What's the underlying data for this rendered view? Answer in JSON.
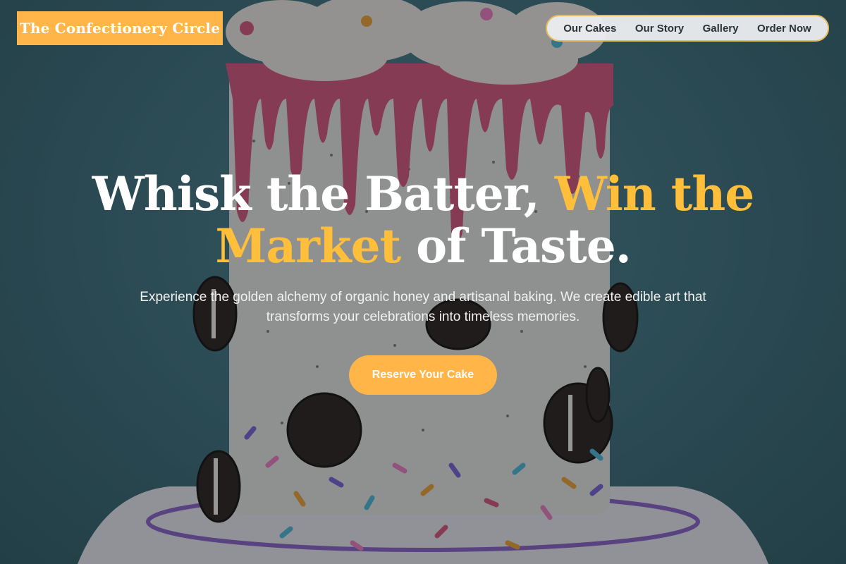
{
  "brand": {
    "name": "The Confectionery Circle"
  },
  "nav": {
    "items": [
      {
        "label": "Our Cakes"
      },
      {
        "label": "Our Story"
      },
      {
        "label": "Gallery"
      },
      {
        "label": "Order Now"
      }
    ]
  },
  "hero": {
    "title_part1": "Whisk the Batter,",
    "title_accent1": "Win the",
    "title_accent2": "Market",
    "title_part2": "of Taste.",
    "subtitle": "Experience the golden alchemy of organic honey and artisanal baking. We create edible art that transforms your celebrations into timeless memories.",
    "cta_label": "Reserve Your Cake"
  },
  "colors": {
    "accent": "#ffb547",
    "title_accent": "#ffbf3a",
    "nav_border": "#e6bd5c",
    "background": "#3f6f7c"
  },
  "icons": {
    "background_image": "drip-cake-with-cookies-and-sprinkles"
  }
}
